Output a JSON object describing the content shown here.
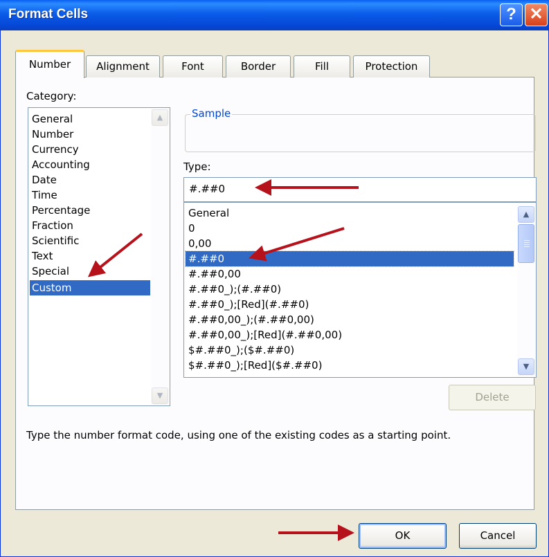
{
  "window": {
    "title": "Format Cells",
    "help_label": "?",
    "close_label": "✕"
  },
  "tabs": [
    {
      "label": "Number"
    },
    {
      "label": "Alignment"
    },
    {
      "label": "Font"
    },
    {
      "label": "Border"
    },
    {
      "label": "Fill"
    },
    {
      "label": "Protection"
    }
  ],
  "category": {
    "label": "Category:",
    "items": [
      "General",
      "Number",
      "Currency",
      "Accounting",
      "Date",
      "Time",
      "Percentage",
      "Fraction",
      "Scientific",
      "Text",
      "Special",
      "Custom"
    ],
    "selected": "Custom"
  },
  "sample": {
    "legend": "Sample"
  },
  "type": {
    "label": "Type:",
    "value": "#.##0",
    "items": [
      "General",
      "0",
      "0,00",
      "#.##0",
      "#.##0,00",
      "#.##0_);(#.##0)",
      "#.##0_);[Red](#.##0)",
      "#.##0,00_);(#.##0,00)",
      "#.##0,00_);[Red](#.##0,00)",
      "$#.##0_);($#.##0)",
      "$#.##0_);[Red]($#.##0)"
    ],
    "selected": "#.##0"
  },
  "buttons": {
    "delete": "Delete",
    "ok": "OK",
    "cancel": "Cancel"
  },
  "hint": "Type the number format code, using one of the existing codes as a starting point.",
  "icons": {
    "scroll_up": "scroll-up-arrow-icon",
    "scroll_down": "scroll-down-arrow-icon",
    "annotation": "red-arrow-icon"
  },
  "colors": {
    "selection": "#316ac5",
    "titlebar": "#0a5ff0",
    "annotation_arrow": "#b5121b"
  }
}
